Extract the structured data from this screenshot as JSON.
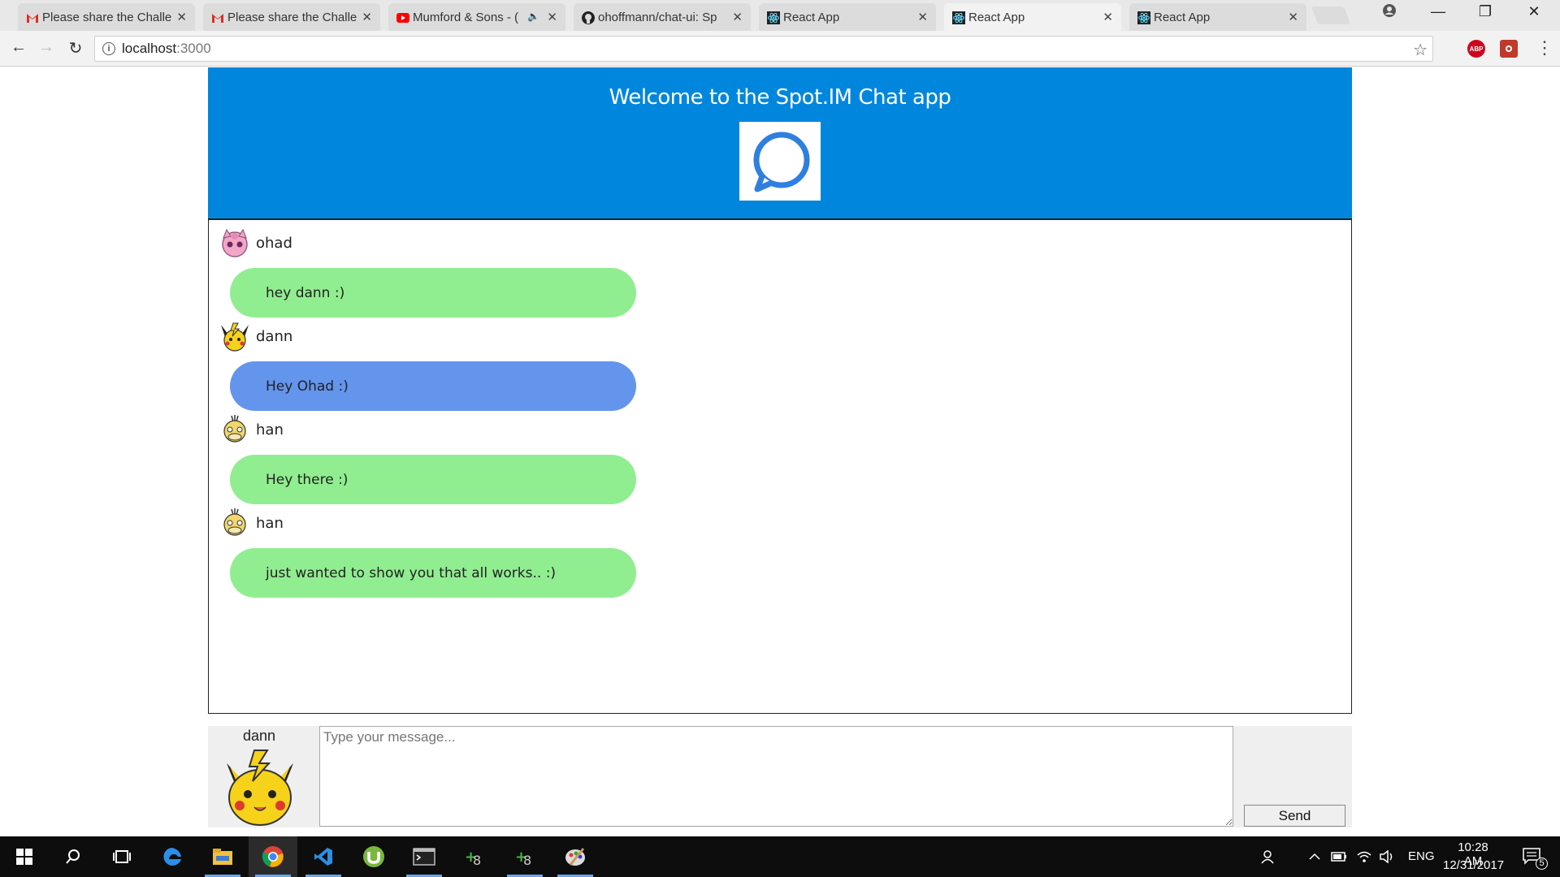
{
  "browser": {
    "tabs": [
      {
        "title": "Please share the Challe",
        "icon": "gmail-icon"
      },
      {
        "title": "Please share the Challe",
        "icon": "gmail-icon"
      },
      {
        "title": "Mumford & Sons - (",
        "icon": "youtube-icon"
      },
      {
        "title": "ohoffmann/chat-ui: Sp",
        "icon": "github-icon"
      },
      {
        "title": "React App",
        "icon": "react-icon"
      },
      {
        "title": "React App",
        "icon": "react-icon"
      },
      {
        "title": "React App",
        "icon": "react-icon"
      }
    ],
    "active_tab": 5,
    "url_host": "localhost",
    "url_port": ":3000",
    "extensions": {
      "adblock_label": "ABP"
    }
  },
  "app": {
    "title": "Welcome to the Spot.IM Chat app",
    "messages": [
      {
        "user": "ohad",
        "text": "hey dann :)",
        "avatar": "jigglypuff-avatar",
        "color": "#90ee90"
      },
      {
        "user": "dann",
        "text": "Hey Ohad :)",
        "avatar": "pikachu-avatar",
        "color": "#6495ed"
      },
      {
        "user": "han",
        "text": "Hey there :)",
        "avatar": "psyduck-avatar",
        "color": "#90ee90"
      },
      {
        "user": "han",
        "text": "just wanted to show you that all works.. :)",
        "avatar": "psyduck-avatar",
        "color": "#90ee90"
      }
    ],
    "compose": {
      "current_user": "dann",
      "placeholder": "Type your message...",
      "send_label": "Send"
    }
  },
  "taskbar": {
    "language": "ENG",
    "time": "10:28 AM",
    "date": "12/31/2017",
    "notifications": "5"
  },
  "colors": {
    "header_blue": "#0086dd",
    "my_bubble": "#6495ed",
    "other_bubble": "#90ee90"
  }
}
